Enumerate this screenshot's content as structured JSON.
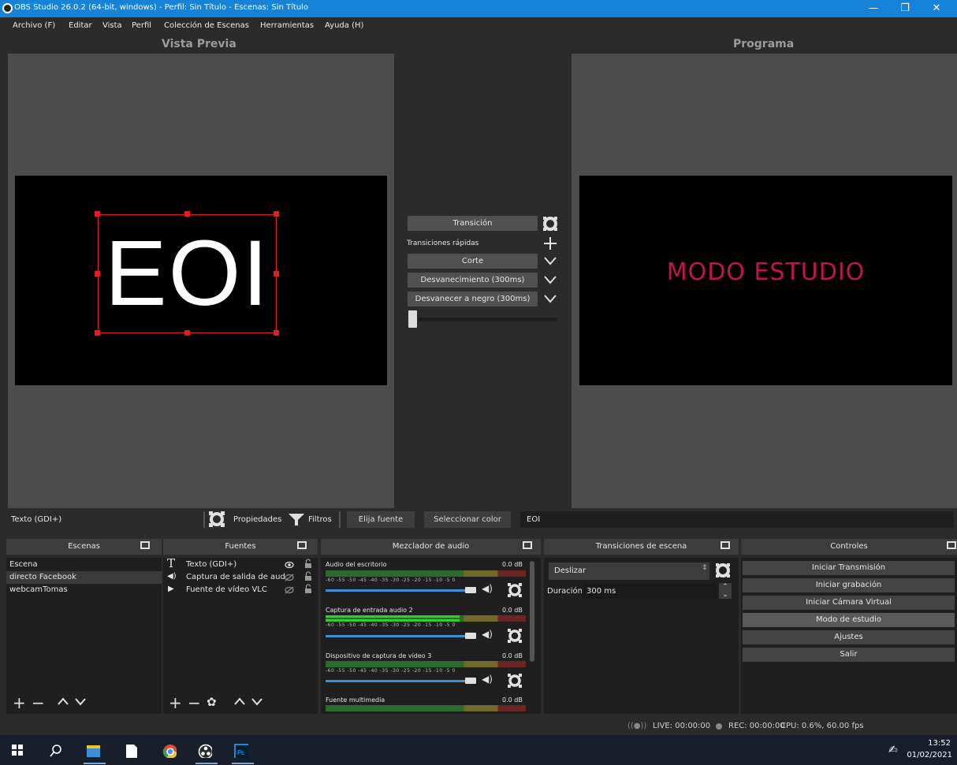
{
  "window": {
    "title": "OBS Studio 26.0.2 (64-bit, windows) - Perfil: Sin Título - Escenas: Sin Título",
    "minimize": "—",
    "maximize": "❐",
    "close": "✕"
  },
  "menu": [
    "Archivo (F)",
    "Editar",
    "Vista",
    "Perfil",
    "Colección de Escenas",
    "Herramientas",
    "Ayuda (H)"
  ],
  "preview": {
    "title": "Vista Previa",
    "source_text": "EOI"
  },
  "program": {
    "title": "Programa",
    "overlay_text": "MODO ESTUDIO"
  },
  "transition": {
    "button": "Transición",
    "quick_label": "Transiciones rápidas",
    "items": [
      "Corte",
      "Desvanecimiento (300ms)",
      "Desvanecer a negro (300ms)"
    ],
    "tbar_value": 0
  },
  "source_toolbar": {
    "source_name": "Texto (GDI+)",
    "properties": "Propiedades",
    "filters": "Filtros",
    "choose_font": "Elija fuente",
    "select_color": "Seleccionar color",
    "text_value": "EOI"
  },
  "scenes": {
    "title": "Escenas",
    "items": [
      "Escena",
      "directo Facebook",
      "webcamTomas"
    ],
    "selected_index": 1
  },
  "sources": {
    "title": "Fuentes",
    "items": [
      {
        "icon": "text-icon",
        "label": "Texto (GDI+)"
      },
      {
        "icon": "speaker-icon",
        "label": "Captura de salida de aud"
      },
      {
        "icon": "play-icon",
        "label": "Fuente de vídeo VLC"
      }
    ]
  },
  "mixer": {
    "title": "Mezclador de audio",
    "ticks": [
      "-60",
      "-55",
      "-50",
      "-45",
      "-40",
      "-35",
      "-30",
      "-25",
      "-20",
      "-15",
      "-10",
      "-5",
      "0"
    ],
    "channels": [
      {
        "name": "Audio del escritorio",
        "db": "0.0 dB"
      },
      {
        "name": "Captura de entrada audio 2",
        "db": "0.0 dB"
      },
      {
        "name": "Dispositivo de captura de vídeo 3",
        "db": "0.0 dB"
      },
      {
        "name": "Fuente multimedia",
        "db": "0.0 dB"
      }
    ]
  },
  "scene_transitions": {
    "title": "Transiciones de escena",
    "selected": "Deslizar",
    "duration_label": "Duración",
    "duration_value": "300 ms"
  },
  "controls": {
    "title": "Controles",
    "buttons": [
      "Iniciar Transmisión",
      "Iniciar grabación",
      "Iniciar Cámara Virtual",
      "Modo de estudio",
      "Ajustes",
      "Salir"
    ],
    "active_index": 3
  },
  "status": {
    "live": "LIVE: 00:00:00",
    "rec": "REC: 00:00:00",
    "cpu": "CPU: 0.6%, 60.00 fps"
  },
  "taskbar": {
    "time": "13:52",
    "date": "01/02/2021"
  },
  "colors": {
    "titlebar": "#1682d8",
    "selection": "#e02020",
    "studio_text": "#c3134d",
    "slider": "#3d8fd6"
  }
}
